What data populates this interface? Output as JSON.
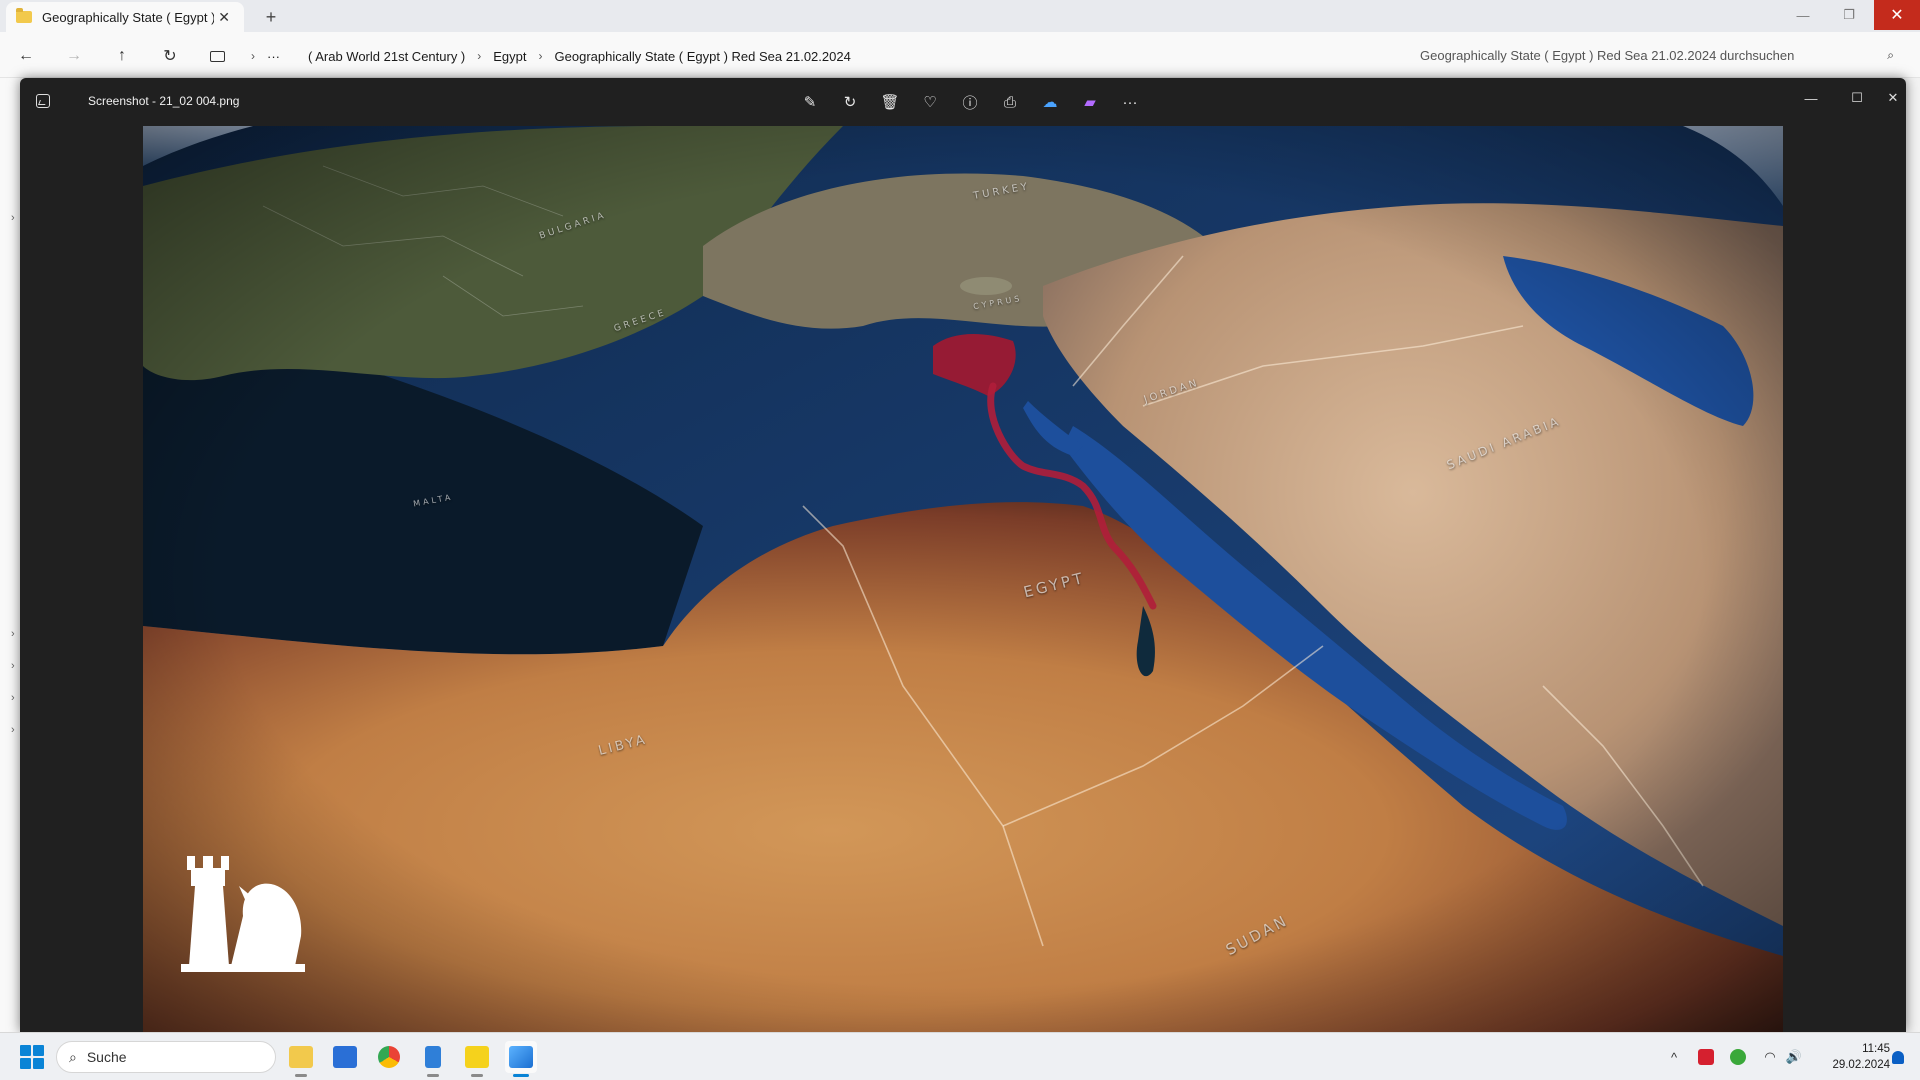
{
  "explorer": {
    "tab_title": "Geographically State ( Egypt )",
    "tab_close": "✕",
    "new_tab": "+",
    "window_controls": {
      "minimize": "—",
      "restore": "❐",
      "close": "✕"
    },
    "nav": {
      "back": "←",
      "forward": "→",
      "up": "↑",
      "refresh": "↻"
    },
    "breadcrumb": {
      "more": "···",
      "items": [
        "( Arab World 21st Century )",
        "Egypt",
        "Geographically State ( Egypt ) Red Sea 21.02.2024"
      ],
      "separator": "›"
    },
    "search": {
      "placeholder": "Geographically State ( Egypt ) Red Sea 21.02.2024 durchsuchen",
      "icon": "search-icon"
    },
    "sidebar_chevrons": [
      "›",
      "›",
      "›",
      "›",
      "›"
    ]
  },
  "viewer": {
    "file_name": "Screenshot - 21_02 004.png",
    "toolbar": [
      {
        "name": "edit-image-icon",
        "glyph": "✎"
      },
      {
        "name": "rotate-icon",
        "glyph": "↻"
      },
      {
        "name": "delete-icon",
        "glyph": "🗑"
      },
      {
        "name": "favorite-icon",
        "glyph": "♡"
      },
      {
        "name": "info-icon",
        "glyph": "ⓘ"
      },
      {
        "name": "print-icon",
        "glyph": "⎙"
      },
      {
        "name": "onedrive-icon",
        "glyph": "☁"
      },
      {
        "name": "clipchamp-icon",
        "glyph": "▰"
      },
      {
        "name": "more-options-icon",
        "glyph": "···"
      }
    ],
    "window_controls": {
      "minimize": "—",
      "maximize": "☐",
      "close": "✕"
    },
    "map_labels": {
      "egypt": "EGYPT",
      "libya": "LIBYA",
      "sudan": "SUDAN",
      "saudi_arabia": "SAUDI ARABIA",
      "jordan": "JORDAN",
      "turkey": "TURKEY",
      "greece": "GREECE",
      "cyprus": "CYPRUS",
      "bulgaria": "BULGARIA",
      "malta": "MALTA"
    },
    "colors": {
      "nile_highlight": "#b01e3a",
      "sea": "#1b3f7a",
      "desert": "#c4894a"
    }
  },
  "taskbar": {
    "search_label": "Suche",
    "apps": [
      "file-explorer-icon",
      "microsoft-store-icon",
      "chrome-icon",
      "notepad-icon",
      "player-icon",
      "photos-icon"
    ],
    "tray": {
      "chevron": "^",
      "time": "11:45",
      "date": "29.02.2024"
    }
  }
}
